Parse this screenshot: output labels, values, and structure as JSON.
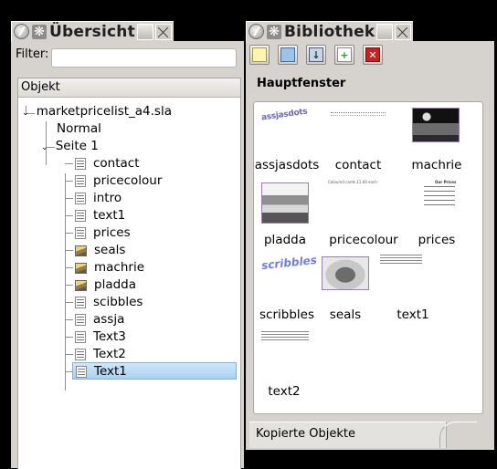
{
  "overview": {
    "title": "Übersicht",
    "filter_label": "Filter:",
    "filter_value": "",
    "column_header": "Objekt",
    "document": "marketpricelist_a4.sla",
    "master": "Normal",
    "page": "Seite 1",
    "items": [
      {
        "label": "contact",
        "icon": "text-frame-icon"
      },
      {
        "label": "pricecolour",
        "icon": "text-frame-icon"
      },
      {
        "label": "intro",
        "icon": "text-frame-icon"
      },
      {
        "label": "text1",
        "icon": "text-frame-icon"
      },
      {
        "label": "prices",
        "icon": "text-frame-icon"
      },
      {
        "label": "seals",
        "icon": "image-frame-icon"
      },
      {
        "label": "machrie",
        "icon": "image-frame-icon"
      },
      {
        "label": "pladda",
        "icon": "image-frame-icon"
      },
      {
        "label": "scibbles",
        "icon": "text-frame-icon"
      },
      {
        "label": "assja",
        "icon": "text-frame-icon"
      },
      {
        "label": "Text3",
        "icon": "text-frame-icon"
      },
      {
        "label": "Text2",
        "icon": "text-frame-icon"
      },
      {
        "label": "Text1",
        "icon": "text-frame-icon",
        "selected": true
      }
    ]
  },
  "library": {
    "title": "Bibliothek",
    "heading": "Hauptfenster",
    "toolbar": [
      "new-library-icon",
      "open-library-icon",
      "save-library-icon",
      "import-icon",
      "close-library-icon"
    ],
    "items": [
      "assjasdots",
      "contact",
      "machrie",
      "pladda",
      "pricecolour",
      "prices",
      "scribbles",
      "seals",
      "text1",
      "text2"
    ],
    "thumb_texts": {
      "assjasdots": "assjasdots",
      "contact": "Coloured cards £1.00 each",
      "prices_heading": "Our Prices",
      "scribbles": "scribbles"
    },
    "bottom_tab": "Kopierte Objekte"
  },
  "colors": {
    "selection": "#a9d2f1",
    "panel": "#d6d3ce",
    "close_button": "#cc2020"
  }
}
